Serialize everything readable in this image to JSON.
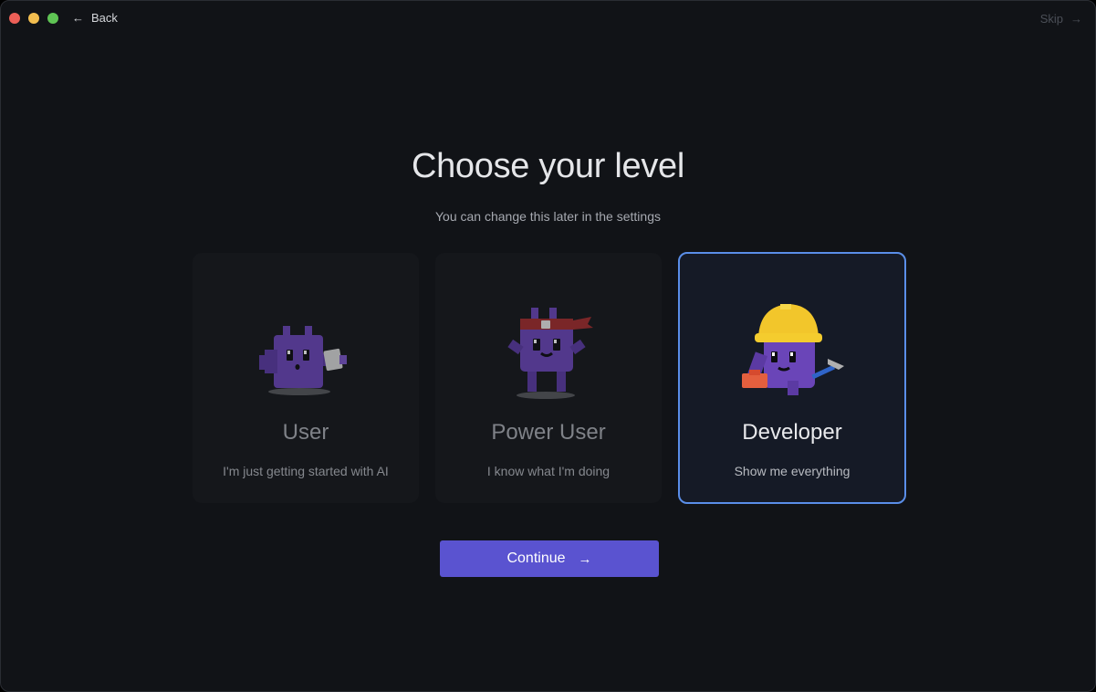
{
  "nav": {
    "back_label": "Back",
    "skip_label": "Skip"
  },
  "heading": "Choose your level",
  "subheading": "You can change this later in the settings",
  "levels": [
    {
      "title": "User",
      "description": "I'm just getting started with AI",
      "selected": false,
      "mascot": "robot-with-paper-icon"
    },
    {
      "title": "Power User",
      "description": "I know what I'm doing",
      "selected": false,
      "mascot": "robot-with-headband-icon"
    },
    {
      "title": "Developer",
      "description": "Show me everything",
      "selected": true,
      "mascot": "robot-with-hardhat-icon"
    }
  ],
  "continue_label": "Continue",
  "colors": {
    "background": "#111317",
    "accent": "#5a53d0",
    "selected_border": "#5a8ee8",
    "mascot_purple": "#6a45b8"
  }
}
